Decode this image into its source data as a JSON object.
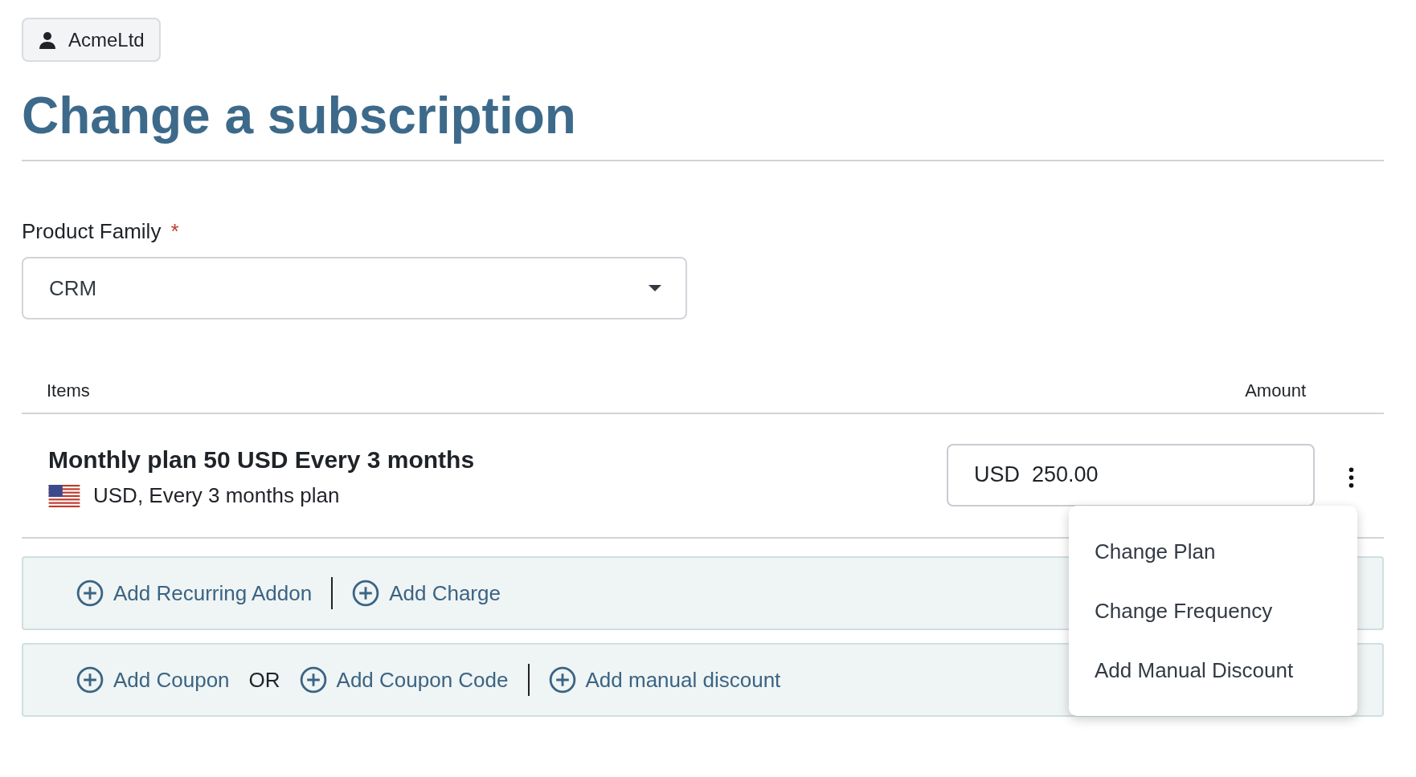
{
  "account": {
    "label": "AcmeLtd"
  },
  "title": "Change a subscription",
  "product_family": {
    "label": "Product Family",
    "required_mark": "*",
    "value": "CRM"
  },
  "items_header": {
    "column_1": "Items",
    "column_2": "Amount"
  },
  "items": [
    {
      "name": "Monthly plan 50 USD Every 3 months",
      "detail": "USD, Every 3 months plan",
      "amount": "USD  250.00",
      "menu_open": true
    }
  ],
  "item_menu": [
    "Change Plan",
    "Change Frequency",
    "Add Manual Discount"
  ],
  "action_bars": [
    [
      {
        "kind": "link",
        "label": "Add Recurring Addon",
        "divider_before": false
      },
      {
        "kind": "link",
        "label": "Add Charge",
        "divider_before": true
      }
    ],
    [
      {
        "kind": "link",
        "label": "Add Coupon",
        "divider_before": false
      },
      {
        "kind": "text",
        "label": "OR",
        "divider_before": false
      },
      {
        "kind": "link",
        "label": "Add Coupon Code",
        "divider_before": false
      },
      {
        "kind": "link",
        "label": "Add manual discount",
        "divider_before": true
      }
    ]
  ]
}
